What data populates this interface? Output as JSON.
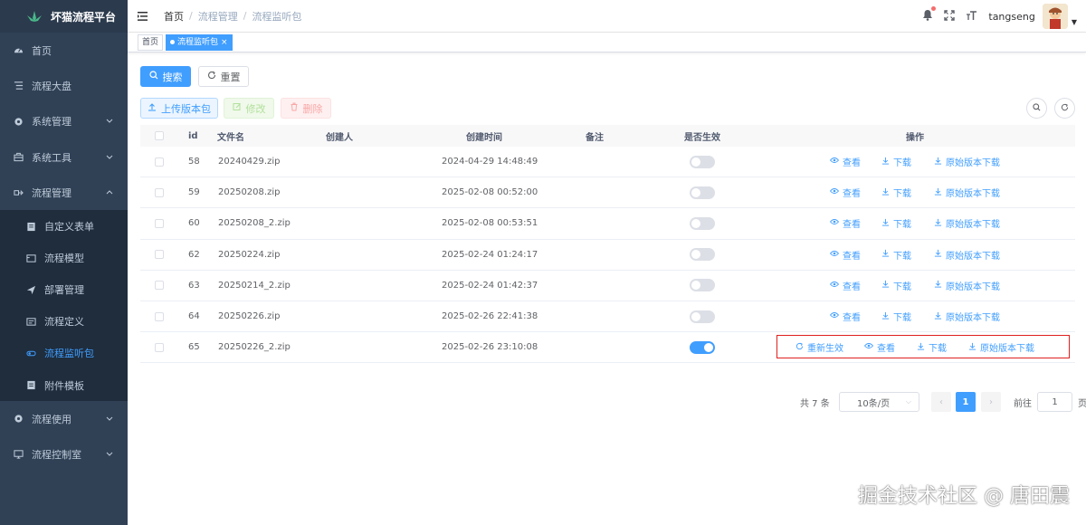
{
  "app": {
    "title": "坏猫流程平台"
  },
  "sidebar": {
    "items": [
      {
        "label": "首页",
        "icon": "dashboard-icon"
      },
      {
        "label": "流程大盘",
        "icon": "list-icon"
      },
      {
        "label": "系统管理",
        "icon": "gear-icon",
        "expandable": true
      },
      {
        "label": "系统工具",
        "icon": "toolbox-icon",
        "expandable": true
      },
      {
        "label": "流程管理",
        "icon": "flow-icon",
        "expandable": true,
        "expanded": true
      }
    ],
    "subitems": [
      {
        "label": "自定义表单",
        "icon": "form-icon"
      },
      {
        "label": "流程模型",
        "icon": "model-icon"
      },
      {
        "label": "部署管理",
        "icon": "send-icon"
      },
      {
        "label": "流程定义",
        "icon": "definition-icon"
      },
      {
        "label": "流程监听包",
        "icon": "package-icon",
        "active": true
      },
      {
        "label": "附件模板",
        "icon": "attachment-icon"
      }
    ],
    "bottom_items": [
      {
        "label": "流程使用",
        "icon": "gear-icon",
        "expandable": true
      },
      {
        "label": "流程控制室",
        "icon": "monitor-icon",
        "expandable": true
      }
    ]
  },
  "header": {
    "breadcrumb": [
      "首页",
      "流程管理",
      "流程监听包"
    ],
    "username": "tangseng"
  },
  "tags": {
    "items": [
      {
        "label": "首页",
        "active": false
      },
      {
        "label": "流程监听包",
        "active": true
      }
    ]
  },
  "toolbar": {
    "search_label": "搜索",
    "reset_label": "重置",
    "upload_label": "上传版本包",
    "edit_label": "修改",
    "delete_label": "删除"
  },
  "table": {
    "columns": [
      "id",
      "文件名",
      "创建人",
      "创建时间",
      "备注",
      "是否生效",
      "操作"
    ],
    "rows": [
      {
        "id": "58",
        "filename": "20240429.zip",
        "creator": "",
        "created": "2024-04-29 14:48:49",
        "remark": "",
        "active": false
      },
      {
        "id": "59",
        "filename": "20250208.zip",
        "creator": "",
        "created": "2025-02-08 00:52:00",
        "remark": "",
        "active": false
      },
      {
        "id": "60",
        "filename": "20250208_2.zip",
        "creator": "",
        "created": "2025-02-08 00:53:51",
        "remark": "",
        "active": false
      },
      {
        "id": "62",
        "filename": "20250224.zip",
        "creator": "",
        "created": "2025-02-24 01:24:17",
        "remark": "",
        "active": false
      },
      {
        "id": "63",
        "filename": "20250214_2.zip",
        "creator": "",
        "created": "2025-02-24 01:42:37",
        "remark": "",
        "active": false
      },
      {
        "id": "64",
        "filename": "20250226.zip",
        "creator": "",
        "created": "2025-02-26 22:41:38",
        "remark": "",
        "active": false
      },
      {
        "id": "65",
        "filename": "20250226_2.zip",
        "creator": "",
        "created": "2025-02-26 23:10:08",
        "remark": "",
        "active": true
      }
    ],
    "actions": {
      "reactivate": "重新生效",
      "view": "查看",
      "download": "下载",
      "download_original": "原始版本下载"
    }
  },
  "pagination": {
    "total_text": "共 7 条",
    "page_size": "10条/页",
    "current_page": "1",
    "prev": "‹",
    "next": "›",
    "goto_label": "前往",
    "goto_value": "1",
    "unit": "页"
  },
  "watermark": "掘金技术社区 @ 唐田震",
  "colors": {
    "primary": "#409eff",
    "sidebar_bg": "#304156",
    "submenu_bg": "#1f2d3d",
    "highlight": "#e02020"
  }
}
